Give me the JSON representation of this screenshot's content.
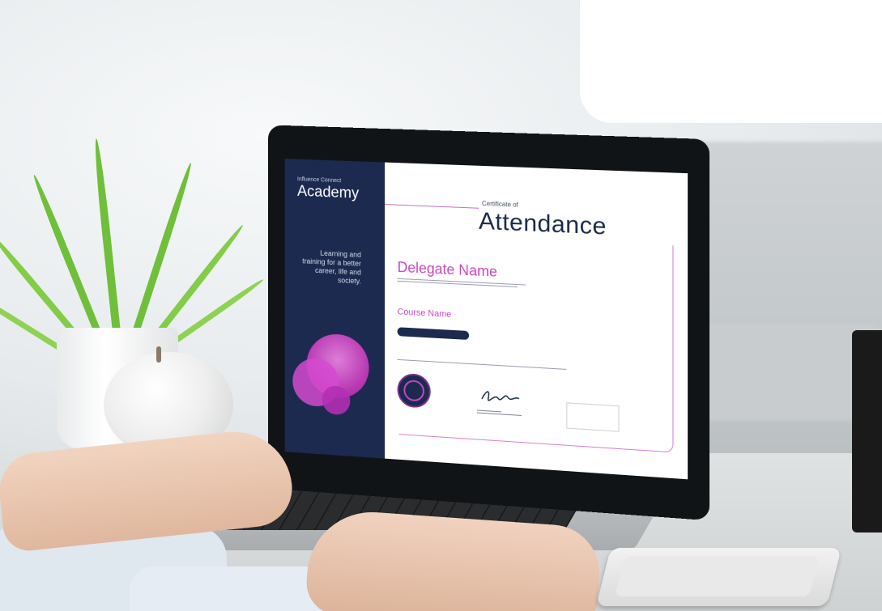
{
  "certificate": {
    "sidebar": {
      "brand_sub": "Influence Connect",
      "brand": "Academy",
      "tagline": "Learning and training for a better career, life and society."
    },
    "heading_small": "Certificate of",
    "heading": "Attendance",
    "delegate": "Delegate Name",
    "course": "Course Name",
    "colors": {
      "navy": "#1b2a4e",
      "magenta": "#c547c2",
      "orb": "#d73fc7"
    }
  },
  "scene": {
    "icons": [
      "plant-icon",
      "apple-icon",
      "laptop-icon",
      "phone-icon",
      "speaker-icon"
    ]
  }
}
